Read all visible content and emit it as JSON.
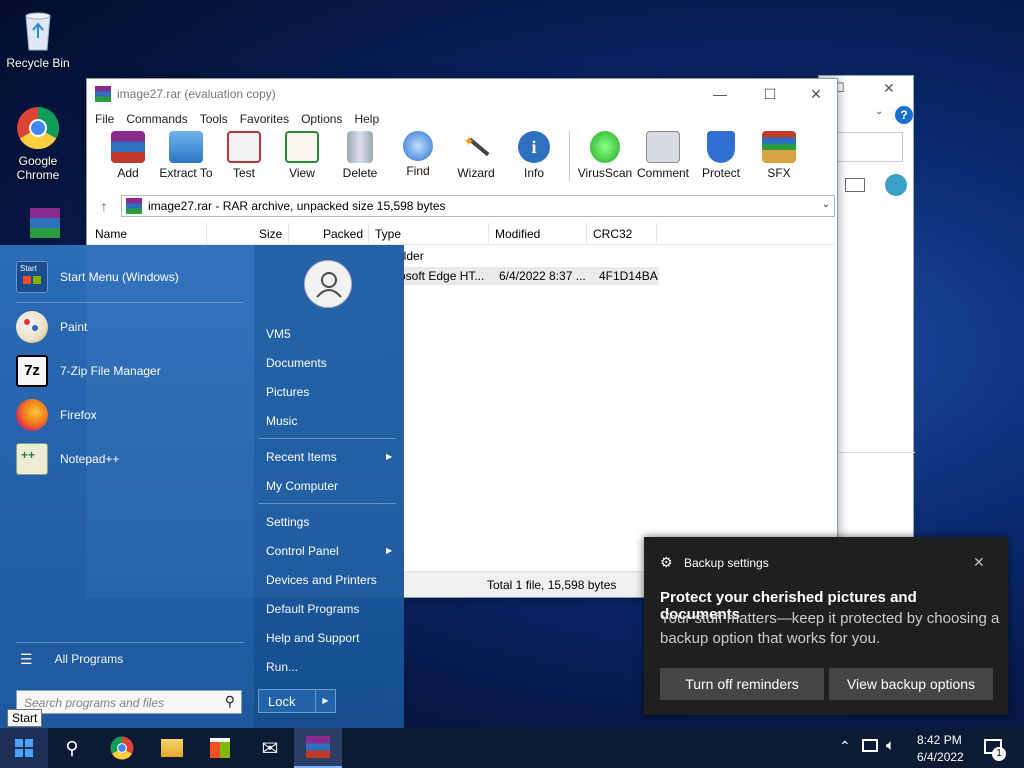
{
  "desktop": {
    "icons": [
      {
        "label": "Recycle Bin",
        "icon": "recycle-bin-icon"
      },
      {
        "label": "Google Chrome",
        "icon": "chrome-icon"
      },
      {
        "label": "",
        "icon": "winrar-icon"
      }
    ]
  },
  "winrar": {
    "title": "image27.rar (evaluation copy)",
    "menu": [
      "File",
      "Commands",
      "Tools",
      "Favorites",
      "Options",
      "Help"
    ],
    "toolbar": [
      "Add",
      "Extract To",
      "Test",
      "View",
      "Delete",
      "Find",
      "Wizard",
      "Info",
      "VirusScan",
      "Comment",
      "Protect",
      "SFX"
    ],
    "address": "image27.rar - RAR archive, unpacked size 15,598 bytes",
    "columns": [
      "Name",
      "Size",
      "Packed",
      "Type",
      "Modified",
      "CRC32"
    ],
    "rows": [
      {
        "type": "older",
        "modified": "",
        "crc": ""
      },
      {
        "type": "osoft Edge HT...",
        "modified": "6/4/2022 8:37 ...",
        "crc": "4F1D14BA"
      }
    ],
    "status": "Total 1 file, 15,598 bytes"
  },
  "start_menu": {
    "pinned": [
      {
        "label": "Start Menu (Windows)",
        "icon": "start-menu-icon"
      },
      {
        "label": "Paint",
        "icon": "paint-icon"
      },
      {
        "label": "7-Zip File Manager",
        "icon": "7zip-icon"
      },
      {
        "label": "Firefox",
        "icon": "firefox-icon"
      },
      {
        "label": "Notepad++",
        "icon": "notepadpp-icon"
      }
    ],
    "all_programs": "All Programs",
    "search_placeholder": "Search programs and files",
    "right": [
      "VM5",
      "Documents",
      "Pictures",
      "Music",
      "Recent Items",
      "My Computer",
      "Settings",
      "Control Panel",
      "Devices and Printers",
      "Default Programs",
      "Help and Support",
      "Run..."
    ],
    "lock": "Lock",
    "start_tooltip": "Start"
  },
  "toast": {
    "app": "Backup settings",
    "heading": "Protect your cherished pictures and documents",
    "body": "Your stuff matters—keep it protected by choosing a backup option that works for you.",
    "button1": "Turn off reminders",
    "button2": "View backup options"
  },
  "taskbar": {
    "time": "8:42 PM",
    "date": "6/4/2022",
    "notification_count": "1"
  }
}
